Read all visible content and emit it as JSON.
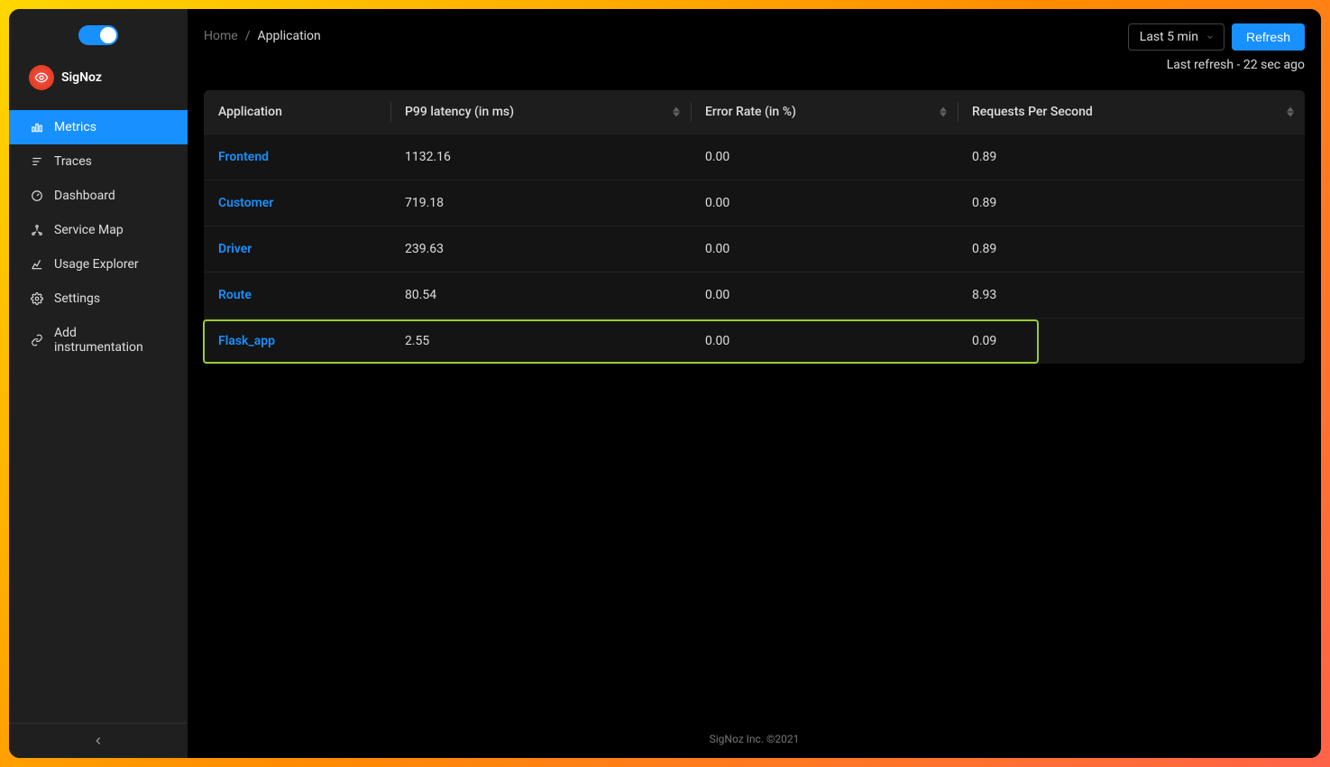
{
  "brand": {
    "name": "SigNoz"
  },
  "sidebar": {
    "items": [
      {
        "label": "Metrics",
        "active": true
      },
      {
        "label": "Traces",
        "active": false
      },
      {
        "label": "Dashboard",
        "active": false
      },
      {
        "label": "Service Map",
        "active": false
      },
      {
        "label": "Usage Explorer",
        "active": false
      },
      {
        "label": "Settings",
        "active": false
      },
      {
        "label": "Add instrumentation",
        "active": false
      }
    ]
  },
  "breadcrumb": {
    "home": "Home",
    "sep": "/",
    "current": "Application"
  },
  "controls": {
    "time_range": "Last 5 min",
    "refresh_label": "Refresh",
    "last_refresh": "Last refresh - 22 sec ago"
  },
  "table": {
    "columns": [
      {
        "label": "Application",
        "sortable": false
      },
      {
        "label": "P99 latency (in ms)",
        "sortable": true
      },
      {
        "label": "Error Rate (in %)",
        "sortable": true
      },
      {
        "label": "Requests Per Second",
        "sortable": true
      }
    ],
    "rows": [
      {
        "app": "Frontend",
        "p99": "1132.16",
        "err": "0.00",
        "rps": "0.89",
        "highlighted": false
      },
      {
        "app": "Customer",
        "p99": "719.18",
        "err": "0.00",
        "rps": "0.89",
        "highlighted": false
      },
      {
        "app": "Driver",
        "p99": "239.63",
        "err": "0.00",
        "rps": "0.89",
        "highlighted": false
      },
      {
        "app": "Route",
        "p99": "80.54",
        "err": "0.00",
        "rps": "8.93",
        "highlighted": false
      },
      {
        "app": "Flask_app",
        "p99": "2.55",
        "err": "0.00",
        "rps": "0.09",
        "highlighted": true
      }
    ]
  },
  "footer": {
    "text": "SigNoz Inc. ©2021"
  }
}
